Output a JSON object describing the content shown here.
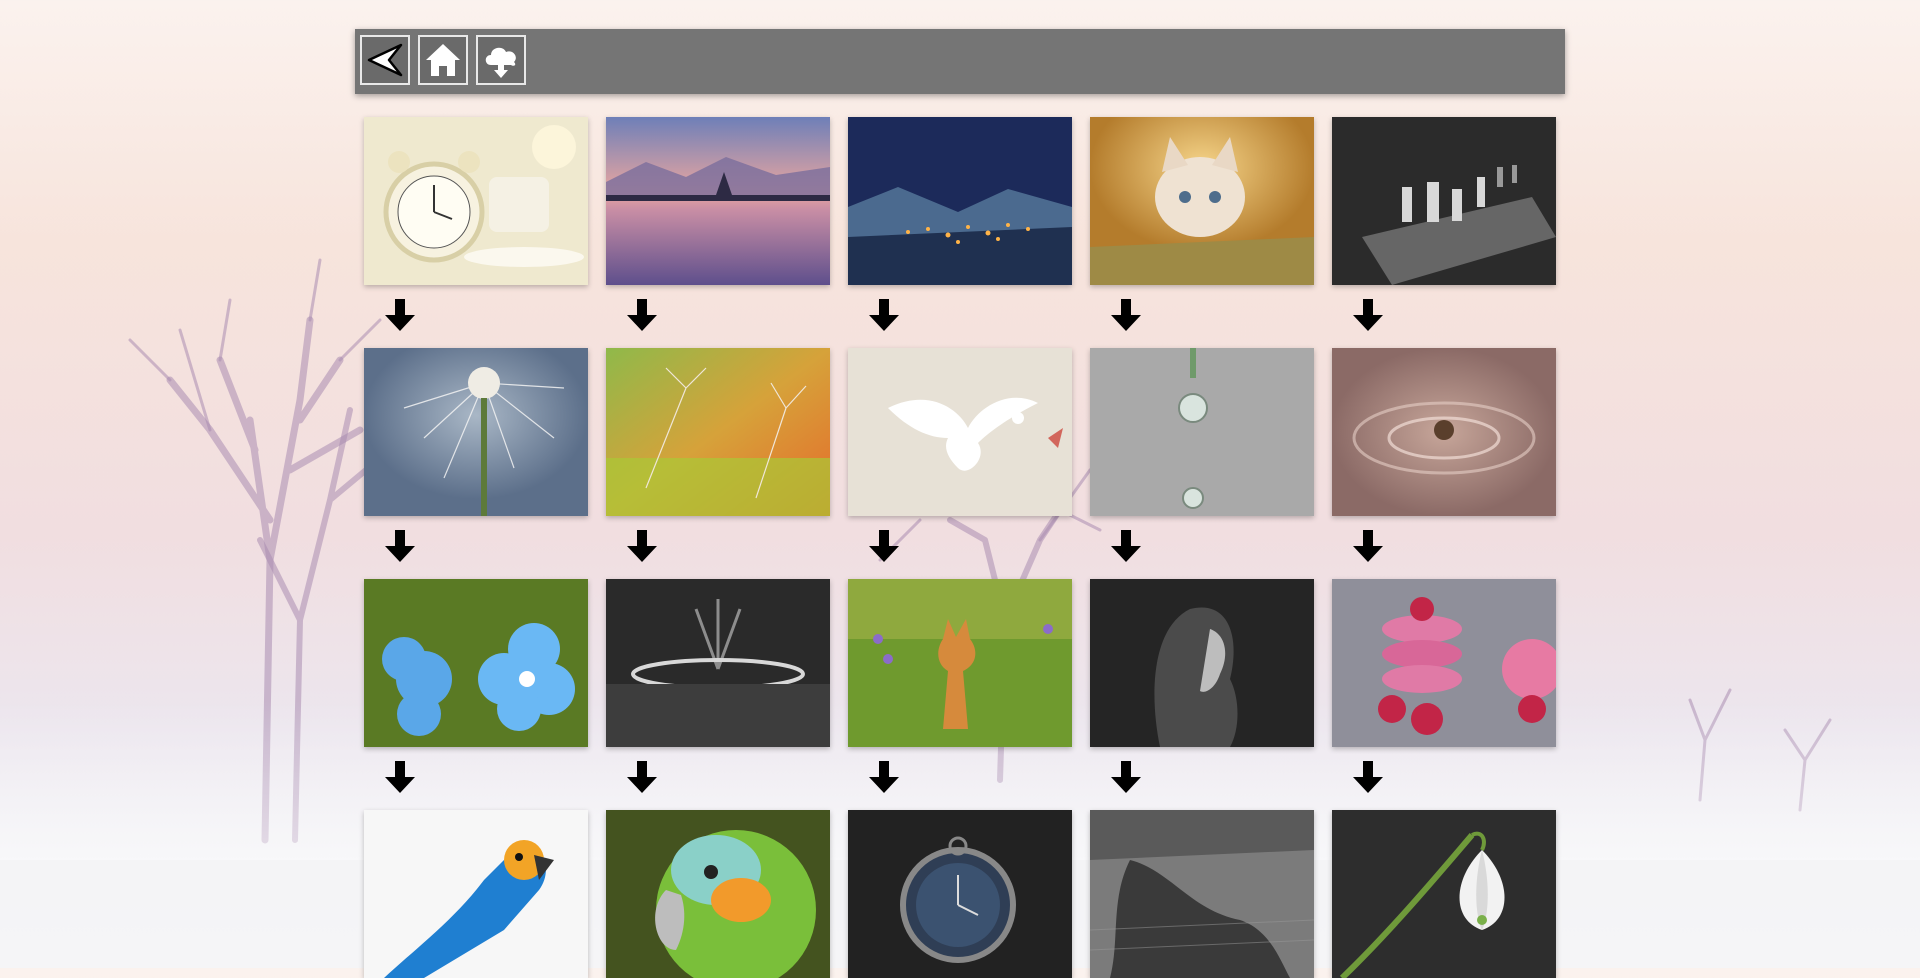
{
  "toolbar": {
    "buttons": [
      {
        "icon": "back-arrow-icon"
      },
      {
        "icon": "home-icon"
      },
      {
        "icon": "cloud-download-icon"
      }
    ]
  },
  "gallery": {
    "rows": [
      [
        "alarm-clock-photo",
        "lake-sunset-photo",
        "night-village-photo",
        "kitten-photo",
        "chess-board-photo"
      ],
      [
        "dandelion-photo",
        "dandelion-seeds-photo",
        "white-dove-photo",
        "water-drop-photo",
        "water-splash-photo"
      ],
      [
        "blue-flowers-photo",
        "fountain-photo",
        "fox-photo",
        "girl-portrait-photo",
        "macarons-raspberries-photo"
      ],
      [
        "blue-macaw-photo",
        "green-parrot-photo",
        "pocket-watch-photo",
        "street-reflection-photo",
        "snowdrop-photo"
      ]
    ]
  },
  "colors": {
    "toolbar": "#757575",
    "arrow": "#000000"
  }
}
